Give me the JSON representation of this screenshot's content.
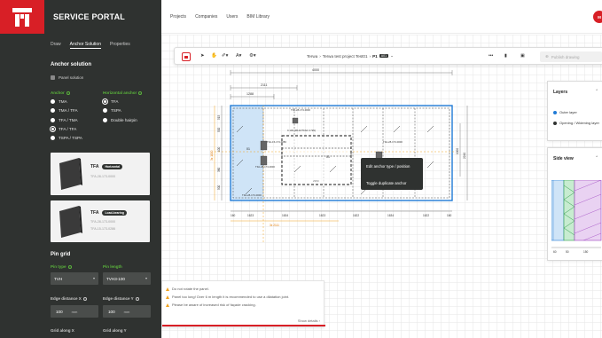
{
  "app": {
    "title": "SERVICE PORTAL",
    "brand_color": "#d81f26",
    "sidebar_bg": "#2f3230",
    "accent_green": "#5ab43c"
  },
  "sidebar": {
    "tabs": [
      {
        "label": "Draw",
        "active": false
      },
      {
        "label": "Anchor Solution",
        "active": true
      },
      {
        "label": "Properties",
        "active": false
      }
    ],
    "anchor_solution": {
      "title": "Anchor solution",
      "panel_solution_label": "Panel solution",
      "anchor_heading": "Anchor",
      "horizontal_anchor_heading": "Horizontal anchor",
      "anchor_options": [
        {
          "label": "TMA",
          "selected": false
        },
        {
          "label": "TMA / TFA",
          "selected": false
        },
        {
          "label": "TFA / TMA",
          "selected": false
        },
        {
          "label": "TFA / TFA",
          "selected": true
        },
        {
          "label": "TSPA / TSPA",
          "selected": false
        }
      ],
      "horizontal_options": [
        {
          "label": "TFA",
          "selected": true
        },
        {
          "label": "TSPA",
          "selected": false
        },
        {
          "label": "Double hairpin",
          "selected": false
        }
      ],
      "cards": [
        {
          "title": "TFA",
          "badge": "Horizontal",
          "code": "TFA-28-173-0000"
        },
        {
          "title": "TFA",
          "badge": "Load-bearing",
          "code1": "TFA-28-173-0000",
          "code2": "TFA-15-173-0286"
        }
      ]
    },
    "pin_grid": {
      "title": "Pin grid",
      "pin_type_label": "Pin type",
      "pin_length_label": "Pin length",
      "pin_type_value": "TVH",
      "pin_length_value": "TVH3-100",
      "edge_x_label": "Edge distance X",
      "edge_y_label": "Edge distance Y",
      "edge_x_value": "100",
      "edge_y_value": "100",
      "unit": "mm",
      "grid_x_label": "Grid along X",
      "grid_y_label": "Grid along Y"
    }
  },
  "topnav": {
    "items": [
      "Projects",
      "Companies",
      "Users",
      "BIM Library"
    ],
    "avatar_initials": "M"
  },
  "toolbar": {
    "breadcrumb": [
      "Terwa",
      "Terwa test project Test01"
    ],
    "page_label": "P1",
    "page_badge": "A01",
    "publish_label": "Publish drawing"
  },
  "drawing": {
    "dims_top": [
      "4000",
      "2111",
      "1288"
    ],
    "dims_bottom": [
      "160",
      "1623",
      "1634",
      "1623",
      "1622",
      "1634",
      "1622",
      "160"
    ],
    "dims_bottom_total": "3x 2111",
    "dims_left": [
      "515",
      "500",
      "100",
      "380",
      "500"
    ],
    "dims_left_red": "3x 1000",
    "dim_right": "2240",
    "dim_right_inner": "1000",
    "anchor_labels": [
      "TFA-28-173-0000",
      "TFA-15-173-0286",
      "TFA-28-173-0000",
      "TFA-28-173-0000",
      "0.100 (M120/TFA0 3.7kN)",
      "TFA-28-173-0000"
    ],
    "center_label": "01",
    "side_label": "01",
    "panel_code": "2950"
  },
  "context_menu": {
    "items": [
      "Edit anchor type / position",
      "Toggle duplicate anchor"
    ]
  },
  "layers_panel": {
    "title": "Layers",
    "items": [
      {
        "label": "Outer layer",
        "color": "#1f7ad6"
      },
      {
        "label": "Opening / Widening layer",
        "color": "#2f3230"
      }
    ]
  },
  "side_view_panel": {
    "title": "Side view",
    "dims": [
      "60",
      "50",
      "150"
    ]
  },
  "notification": {
    "warnings": [
      "Do not rotate the panel.",
      "Panel too long! Over 6 m length it is recommended to use a dilatation joint.",
      "Please be aware of increased risk of façade cracking."
    ],
    "show_details": "Show details"
  }
}
